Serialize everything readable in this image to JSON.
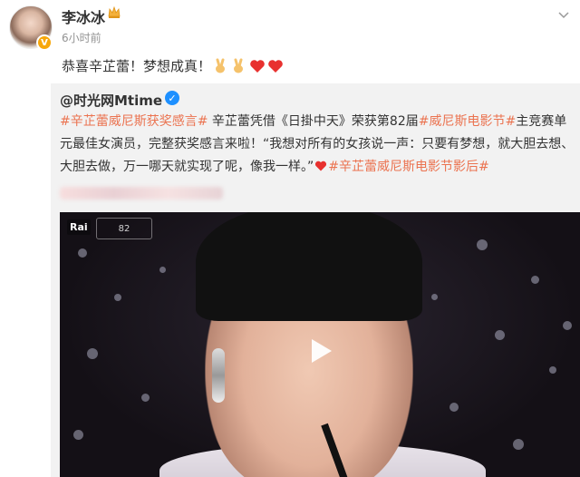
{
  "post": {
    "author": "李冰冰",
    "timestamp": "6小时前",
    "text": "恭喜辛芷蕾！梦想成真！"
  },
  "repost": {
    "author": "@时光网Mtime",
    "segments": [
      {
        "text": "#辛芷蕾威尼斯获奖感言#",
        "tag": true
      },
      {
        "text": " 辛芷蕾凭借《日掛中天》荣获第82届",
        "tag": false
      },
      {
        "text": "#威尼斯电影节#",
        "tag": true
      },
      {
        "text": "主竞赛单元最佳女演员，完整获奖感言来啦！“我想对所有的女孩说一声：只要有梦想，就大胆去想、大胆去做，万一哪天就实现了呢，像我一样。”",
        "tag": false
      },
      {
        "text": "#辛芷蕾威尼斯电影节影后#",
        "tag": true
      }
    ]
  },
  "video": {
    "channel": "Rai",
    "festival": "82"
  },
  "colors": {
    "tag": "#eb7350",
    "verified_gold": "#f7a70b",
    "verified_blue": "#1e90ff"
  }
}
